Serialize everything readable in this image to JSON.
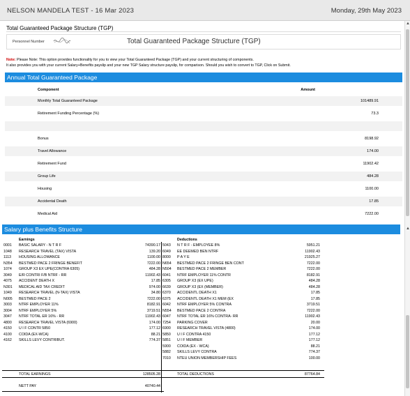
{
  "topbar": {
    "title": "NELSON MANDELA TEST - 16 Mar 2023",
    "date": "Monday, 29th May 2023"
  },
  "page": {
    "title": "Total Guaranteed Package Structure (TGP)"
  },
  "panel": {
    "personnel_label": "Personnel Number",
    "heading": "Total Guaranteed Package Structure (TGP)"
  },
  "note": {
    "prefix": "Note:",
    "line1": "Please Note: This option provides functionality for you to view your Total Guaranteed Package (TGP) and your current structuring of components.",
    "line2": "It also provides you with your current Salary+Benefits payslip and your new TGP Salary structure payslip, for comparison. Should you wish to convert to TGP, Click on Submit."
  },
  "annual": {
    "header": "Annual Total Guaranteed Package",
    "col_component": "Component",
    "col_amount": "Amount",
    "rows": [
      {
        "component": "Monthly Total Guaranteed Package",
        "amount": "101489.91"
      },
      {
        "component": "Retirement Funding Percentage (%)",
        "amount": "73.3"
      },
      {
        "component": "",
        "amount": ""
      },
      {
        "component": "Bonus",
        "amount": "8198.92"
      },
      {
        "component": "Travel Allowance",
        "amount": "174.00"
      },
      {
        "component": "Retirement Fund",
        "amount": "11902.42"
      },
      {
        "component": "Group Life",
        "amount": "484.28"
      },
      {
        "component": "Housing",
        "amount": "1100.00"
      },
      {
        "component": "Accidental Death",
        "amount": "17.85"
      },
      {
        "component": "Medical Aid",
        "amount": "7222.00"
      }
    ]
  },
  "salary": {
    "header": "Salary plus Benefits Structure",
    "earnings_label": "Earnings",
    "deductions_label": "Deductions",
    "earnings": [
      {
        "code": "0001",
        "desc": "BASIC SALARY - N T R F",
        "amount": "74390.17"
      },
      {
        "code": "1048",
        "desc": "RESEARCH TRAVEL (TAX) VISTA",
        "amount": "139.20"
      },
      {
        "code": "1113",
        "desc": "HOUSING ALLOWANCE",
        "amount": "1100.00"
      },
      {
        "code": "N354",
        "desc": "BESTMED PACE 2 FRINGE BENEFIT",
        "amount": "7222.00"
      },
      {
        "code": "1074",
        "desc": "GROUP X3 EX UPE(CONTRA 6305)",
        "amount": "484.28"
      },
      {
        "code": "3049",
        "desc": "E/R CONTRI F/B NTRF - RR",
        "amount": "11902.43"
      },
      {
        "code": "4075",
        "desc": "ACCIDENT DEATH X",
        "amount": "17.85"
      },
      {
        "code": "N301",
        "desc": "MEDICAL AID TAX CREDIT",
        "amount": "974.00"
      },
      {
        "code": "1049",
        "desc": "RESEARCH TRAVEL (N-TAX) VISTA",
        "amount": "34.80"
      },
      {
        "code": "N005",
        "desc": "BESTMED PACE 2",
        "amount": "7222.00"
      },
      {
        "code": "3003",
        "desc": "NTRF EMPLOYER 11%",
        "amount": "8182.91"
      },
      {
        "code": "3004",
        "desc": "NTRF EMPLOYER 5%",
        "amount": "3719.51"
      },
      {
        "code": "3047",
        "desc": "NTRF TOTAL ER 16% - RR",
        "amount": "11902.43"
      },
      {
        "code": "4800",
        "desc": "RESEARCH TRAVEL VISTA (6900)",
        "amount": "174.00"
      },
      {
        "code": "4150",
        "desc": "U I F CONTR 5850",
        "amount": "177.12"
      },
      {
        "code": "4100",
        "desc": "COIDA (EX-WCA)",
        "amount": "88.21"
      },
      {
        "code": "4162",
        "desc": "SKILLS LEVY CONTRIBUT.",
        "amount": "774.37"
      }
    ],
    "deductions": [
      {
        "code": "5043",
        "desc": "N T R F - EMPLOYEE 8%",
        "amount": "5951.21"
      },
      {
        "code": "6049",
        "desc": "EE DEEMED BEN NTRF",
        "amount": "11902.43"
      },
      {
        "code": "8000",
        "desc": "P A Y E",
        "amount": "21925.27"
      },
      {
        "code": "N654",
        "desc": "BESTMED PACE 2 FRINGE BEN CONT",
        "amount": "7222.00"
      },
      {
        "code": "N504",
        "desc": "BESTMED PACE 2 MEMBER",
        "amount": "7222.00"
      },
      {
        "code": "6041",
        "desc": "NTRF EMPLOYER 11% CONTR",
        "amount": "8182.91"
      },
      {
        "code": "6305",
        "desc": "GROUP X3 (EX UPE)",
        "amount": "484.28"
      },
      {
        "code": "6639",
        "desc": "GROUP X3 (EX (MEMBER)",
        "amount": "484.28"
      },
      {
        "code": "6370",
        "desc": "ACCIDENTL DEATH X1",
        "amount": "17.85"
      },
      {
        "code": "6375",
        "desc": "ACCIDENTL DEATH X1 MEM (EX",
        "amount": "17.85"
      },
      {
        "code": "6042",
        "desc": "NTRF EMPLOYER 5% CONTRA",
        "amount": "3719.51"
      },
      {
        "code": "N554",
        "desc": "BESTMED PACE 2 CONTRA",
        "amount": "7222.00"
      },
      {
        "code": "6047",
        "desc": "NTRF TOTAL ER 16% CONTRA- RR",
        "amount": "11902.43"
      },
      {
        "code": "7254",
        "desc": "PARKING COVER",
        "amount": "20.00"
      },
      {
        "code": "6900",
        "desc": "RESEARCH TRAVEL VISTA (4800)",
        "amount": "174.00"
      },
      {
        "code": "5850",
        "desc": "U I F CONTRA 4150",
        "amount": "177.12"
      },
      {
        "code": "5851",
        "desc": "U I F MEMBER",
        "amount": "177.12"
      },
      {
        "code": "5900",
        "desc": "COIDA (EX - WCA)",
        "amount": "88.21"
      },
      {
        "code": "5882",
        "desc": "SKILLS LEVY CONTRA",
        "amount": "774.37"
      },
      {
        "code": "7010",
        "desc": "NTEU UNION MEMBERSHIP FEES",
        "amount": "100.00"
      }
    ],
    "total_earnings_label": "TOTAL EARNINGS",
    "total_earnings": "128505.28",
    "total_deductions_label": "TOTAL DEDUCTIONS",
    "total_deductions": "87764.84",
    "nett_pay_label": "NETT PAY",
    "nett_pay": "40740.44"
  },
  "icons": {
    "scroll_up": "scroll-up-arrow-icon",
    "scroll_down": "scroll-down-arrow-icon"
  },
  "colors": {
    "header_blue": "#1c8cdf",
    "note_red": "#d00000"
  }
}
